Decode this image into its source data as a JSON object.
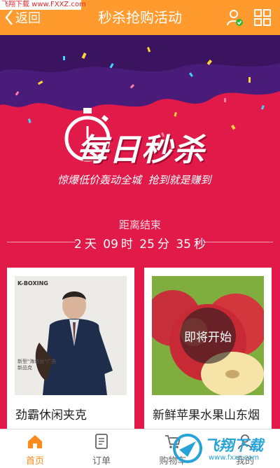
{
  "watermark": {
    "top_left": "飞翔下载 www.FXXZ.com",
    "bottom_right_title": "飞翔下载",
    "bottom_right_url": "www.fxxz.com"
  },
  "header": {
    "back_label": "返回",
    "title": "秒杀抢购活动",
    "user_icon": "user-check-icon",
    "grid_icon": "grid-icon"
  },
  "banner": {
    "headline": "每日秒杀",
    "slogan": "惊爆低价轰动全城  抢到就是赚到",
    "icon": "stopwatch-icon"
  },
  "countdown": {
    "label": "距离结束",
    "days": "2",
    "days_unit": "天",
    "hours": "09",
    "hours_unit": "时",
    "minutes": "25",
    "minutes_unit": "分",
    "seconds": "35",
    "seconds_unit": "秒"
  },
  "products": [
    {
      "name": "劲霸休闲夹克",
      "brand_tag": "K-BOXING",
      "promo_text": "新型\"海岛丝\"广告新品克"
    },
    {
      "name": "新鲜苹果水果山东烟",
      "overlay": "即将开始"
    }
  ],
  "tabbar": [
    {
      "label": "首页",
      "icon": "home-icon",
      "active": true
    },
    {
      "label": "订单",
      "icon": "order-icon",
      "active": false
    },
    {
      "label": "购物车",
      "icon": "cart-icon",
      "active": false
    },
    {
      "label": "我的",
      "icon": "user-icon",
      "active": false
    }
  ],
  "colors": {
    "header": "#ff9a2e",
    "accent": "#e21a4a",
    "tab_active": "#ff8a1c"
  }
}
